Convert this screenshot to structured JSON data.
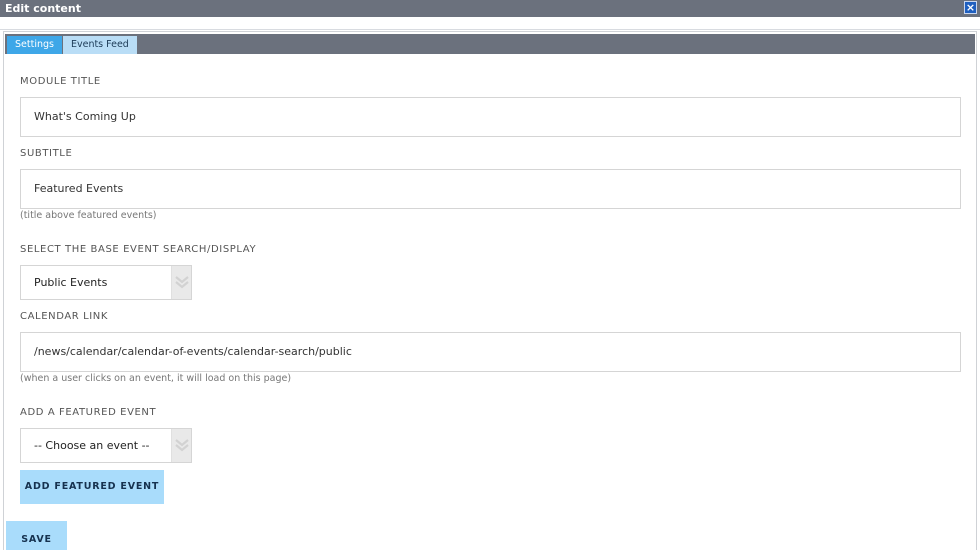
{
  "window": {
    "title": "Edit content",
    "close_glyph": "×"
  },
  "tabs": [
    {
      "label": "Settings",
      "active": true
    },
    {
      "label": "Events Feed",
      "active": false
    }
  ],
  "form": {
    "module_title": {
      "label": "MODULE TITLE",
      "value": "What's Coming Up"
    },
    "subtitle": {
      "label": "SUBTITLE",
      "value": "Featured Events",
      "hint": "(title above featured events)"
    },
    "base_search": {
      "label": "SELECT THE BASE EVENT SEARCH/DISPLAY",
      "value": "Public Events"
    },
    "calendar_link": {
      "label": "CALENDAR LINK",
      "value": "/news/calendar/calendar-of-events/calendar-search/public",
      "hint": "(when a user clicks on an event, it will load on this page)"
    },
    "featured_event": {
      "label": "ADD A FEATURED EVENT",
      "value": "-- Choose an event --"
    },
    "add_featured_button": "ADD FEATURED EVENT",
    "save_button": "SAVE"
  },
  "colors": {
    "titlebar": "#6b717d",
    "tab_active": "#3ea7e8",
    "tab_inactive": "#b9ddf6",
    "button": "#a9dcfb"
  }
}
